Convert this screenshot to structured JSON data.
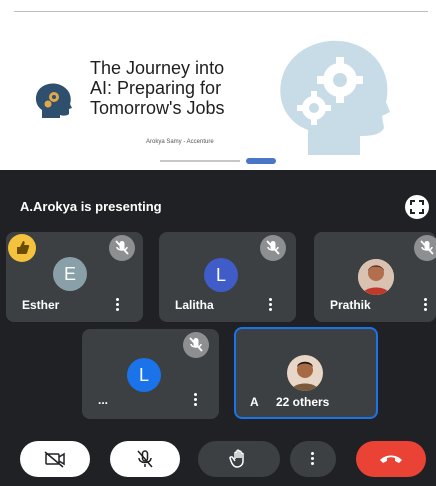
{
  "slide": {
    "title_line1": "The Journey into",
    "title_line2": "AI: Preparing for",
    "title_line3": "Tomorrow's Jobs",
    "credit": "Arokya Samy - Accenture"
  },
  "meeting": {
    "presenting_text": "A.Arokya is presenting",
    "participants": [
      {
        "name": "Esther",
        "initial": "E",
        "avatar_color": "#8aa0a8"
      },
      {
        "name": "Lalitha",
        "initial": "L",
        "avatar_color": "#3f5cc8"
      },
      {
        "name": "Prathik",
        "initial": "",
        "avatar_color": "#c77a5f"
      },
      {
        "name": "...",
        "initial": "L",
        "avatar_color": "#1a73e8"
      }
    ],
    "others": {
      "prefix": "A",
      "text": "22 others"
    }
  },
  "colors": {
    "background": "#202124",
    "tile": "#3c4043",
    "end_call": "#ea4335",
    "active_border": "#1a73e8",
    "hand_raise": "#f4c23c"
  }
}
